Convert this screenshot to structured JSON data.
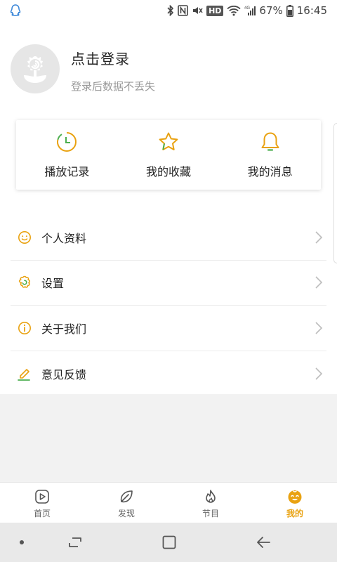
{
  "status_bar": {
    "left_icon": "qq-icon",
    "battery_percent": "67%",
    "time": "16:45",
    "hd_label": "HD",
    "network_label": "4G",
    "icons": [
      "bluetooth-icon",
      "nfc-icon",
      "mute-icon",
      "hd-icon",
      "wifi-icon",
      "signal-icon",
      "battery-icon"
    ]
  },
  "profile": {
    "title": "点击登录",
    "subtitle": "登录后数据不丢失",
    "avatar_icon": "default-avatar-icon"
  },
  "shortcuts": [
    {
      "label": "播放记录",
      "icon": "clock-icon"
    },
    {
      "label": "我的收藏",
      "icon": "star-icon"
    },
    {
      "label": "我的消息",
      "icon": "bell-icon"
    }
  ],
  "menu": [
    {
      "label": "个人资料",
      "icon": "smiley-icon"
    },
    {
      "label": "设置",
      "icon": "settings-flower-icon"
    },
    {
      "label": "关于我们",
      "icon": "info-icon"
    },
    {
      "label": "意见反馈",
      "icon": "pencil-icon"
    }
  ],
  "tabs": [
    {
      "label": "首页",
      "icon": "play-icon",
      "active": false
    },
    {
      "label": "发现",
      "icon": "leaf-icon",
      "active": false
    },
    {
      "label": "节目",
      "icon": "fire-icon",
      "active": false
    },
    {
      "label": "我的",
      "icon": "baby-face-icon",
      "active": true
    }
  ],
  "colors": {
    "accent": "#e9a211",
    "accent_green": "#4caf50",
    "text_primary": "#222222",
    "text_secondary": "#999999"
  }
}
